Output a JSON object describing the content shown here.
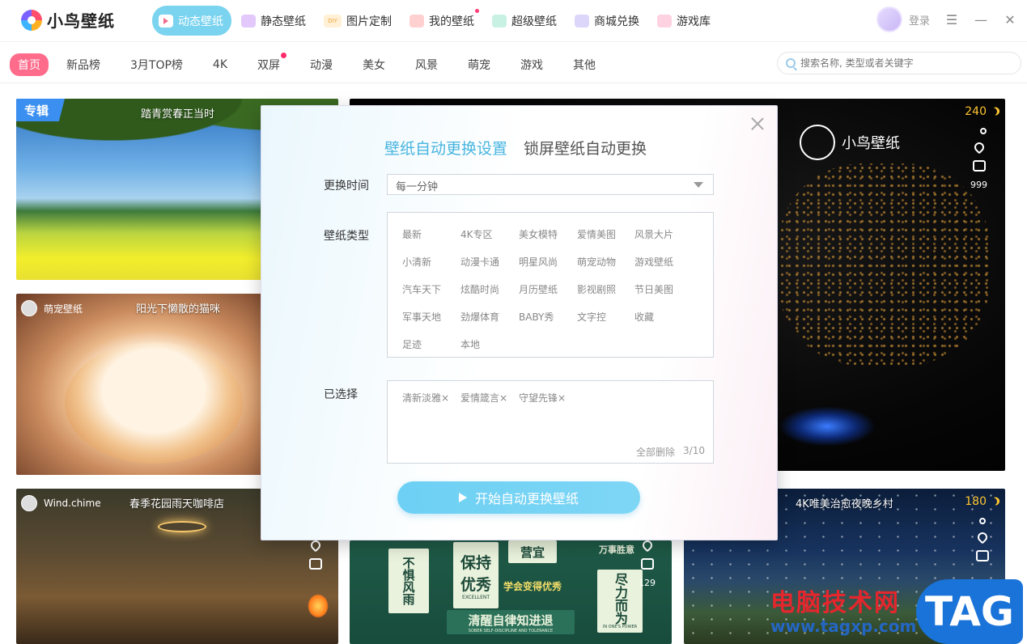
{
  "app": {
    "name": "小鸟壁纸"
  },
  "nav": {
    "items": [
      {
        "label": "动态壁纸",
        "color": "#f06b8c"
      },
      {
        "label": "静态壁纸",
        "color": "#c08cf0"
      },
      {
        "label": "图片定制",
        "color": "#ffc56a"
      },
      {
        "label": "我的壁纸",
        "color": "#f08a8a"
      },
      {
        "label": "超级壁纸",
        "color": "#4dc9a5"
      },
      {
        "label": "商城兑换",
        "color": "#9a8cf2"
      },
      {
        "label": "游戏库",
        "color": "#f26ba0"
      }
    ],
    "login_label": "登录",
    "icon_text_diy": "DIY"
  },
  "categories": [
    "首页",
    "新品榜",
    "3月TOP榜",
    "4K",
    "双屏",
    "动漫",
    "美女",
    "风景",
    "萌宠",
    "游戏",
    "其他"
  ],
  "search": {
    "placeholder": "搜索名称, 类型或者关键字"
  },
  "cards": {
    "c1": {
      "tag": "专辑",
      "title": "踏青赏春正当时"
    },
    "c2": {
      "user": "萌宠壁纸",
      "title": "阳光下懒散的猫咪"
    },
    "c3": {
      "score": "240",
      "comments": "999",
      "brand": "小鸟壁纸"
    },
    "c4": {
      "user": "Wind.chime",
      "title": "春季花园雨天咖啡店"
    },
    "c5": {
      "comments": "129",
      "notes": [
        "不惧风雨",
        "保持优秀",
        "学会变得优秀",
        "清醒自律知进退",
        "尽力而为",
        "营宜",
        "万事胜意"
      ],
      "sub_excellent": "EXCELLENT",
      "sub_discipline": "SOBER SELF-DISCIPLINE AND TOLERANCE",
      "sub_power": "IN ONE'S POWER"
    },
    "c6": {
      "score": "180",
      "title": "4K唯美治愈夜晚乡村"
    }
  },
  "watermark": {
    "site_name": "电脑技术网",
    "url": "www.tagxp.com",
    "tag": "TAG"
  },
  "modal": {
    "tabs": [
      "壁纸自动更换设置",
      "锁屏壁纸自动更换"
    ],
    "interval_label": "更换时间",
    "interval_value": "每一分钟",
    "type_label": "壁纸类型",
    "types": [
      "最新",
      "4K专区",
      "美女模特",
      "爱情美图",
      "风景大片",
      "小清新",
      "动漫卡通",
      "明星风尚",
      "萌宠动物",
      "游戏壁纸",
      "汽车天下",
      "炫酷时尚",
      "月历壁纸",
      "影视剧照",
      "节日美图",
      "军事天地",
      "劲爆体育",
      "BABY秀",
      "文字控",
      "收藏",
      "足迹",
      "本地"
    ],
    "selected_label": "已选择",
    "selected": [
      "清新淡雅×",
      "爱情箴言×",
      "守望先锋×"
    ],
    "clear_all": "全部删除",
    "count": "3/10",
    "start_button": "开始自动更换壁纸"
  }
}
